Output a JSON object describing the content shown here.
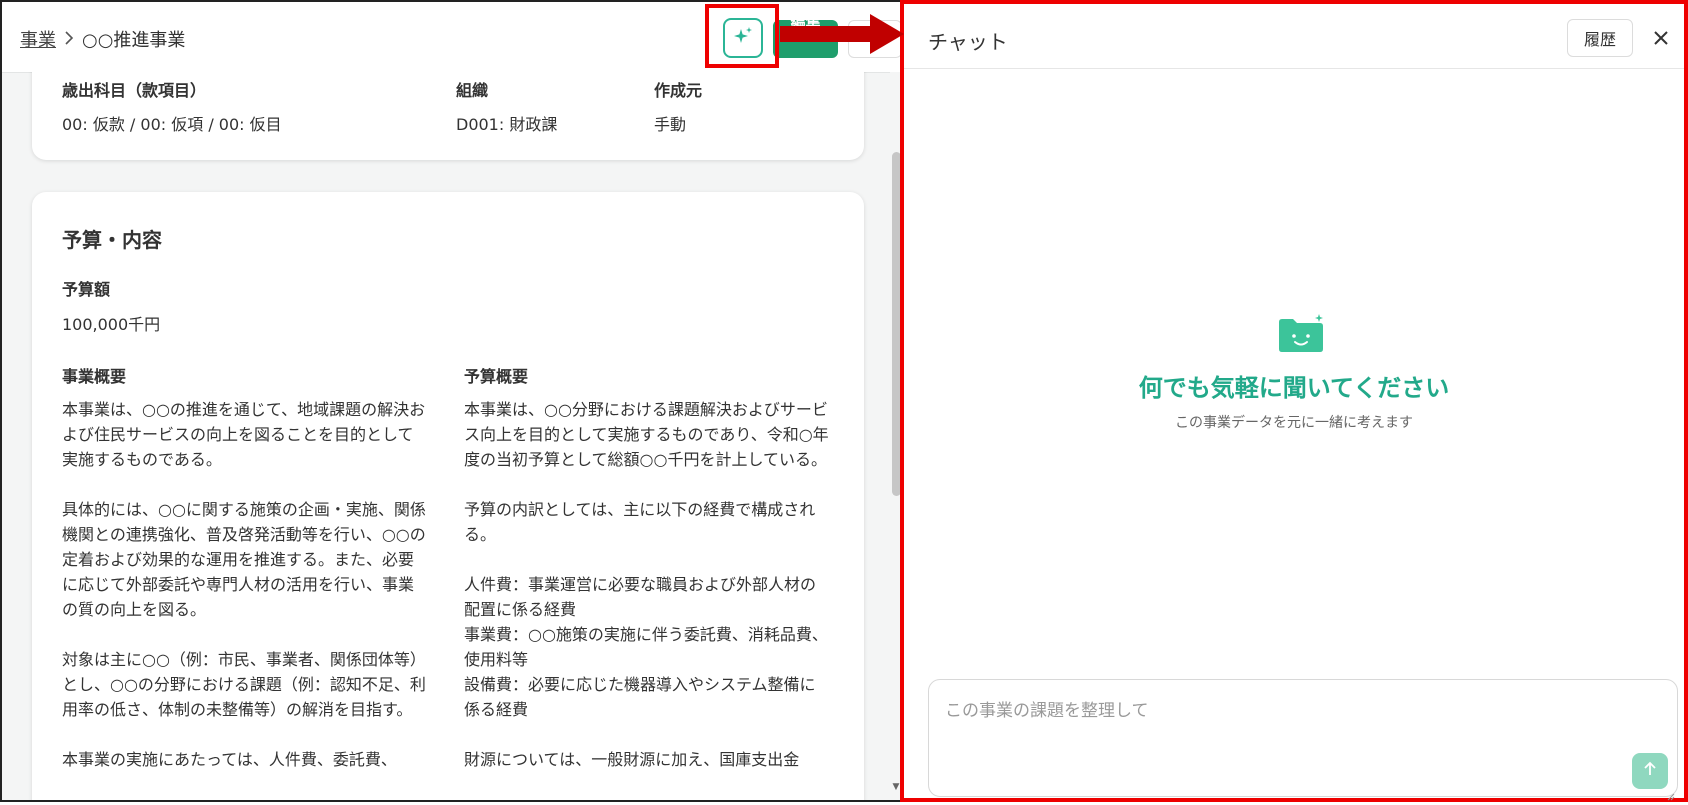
{
  "breadcrumb": {
    "root": "事業",
    "current": "○○推進事業"
  },
  "toolbar": {
    "edit_label": "編集"
  },
  "summary_card": {
    "account_label": "歳出科目（款項目）",
    "account_value": "00: 仮款 / 00: 仮項 / 00: 仮目",
    "org_label": "組織",
    "org_value": "D001: 財政課",
    "creator_label": "作成元",
    "creator_value": "手動"
  },
  "budget_card": {
    "title": "予算・内容",
    "amount_label": "予算額",
    "amount_value": "100,000千円",
    "overview_label": "事業概要",
    "overview_text": "本事業は、○○の推進を通じて、地域課題の解決および住民サービスの向上を図ることを目的として実施するものである。\n\n具体的には、○○に関する施策の企画・実施、関係機関との連携強化、普及啓発活動等を行い、○○の定着および効果的な運用を推進する。また、必要に応じて外部委託や専門人材の活用を行い、事業の質の向上を図る。\n\n対象は主に○○（例：市民、事業者、関係団体等）とし、○○の分野における課題（例：認知不足、利用率の低さ、体制の未整備等）の解消を目指す。\n\n本事業の実施にあたっては、人件費、委託費、",
    "budget_summary_label": "予算概要",
    "budget_summary_text": "本事業は、○○分野における課題解決およびサービス向上を目的として実施するものであり、令和○年度の当初予算として総額○○千円を計上している。\n\n予算の内訳としては、主に以下の経費で構成される。\n\n人件費：事業運営に必要な職員および外部人材の配置に係る経費\n事業費：○○施策の実施に伴う委託費、消耗品費、使用料等\n設備費：必要に応じた機器導入やシステム整備に係る経費\n\n財源については、一般財源に加え、国庫支出金"
  },
  "chat": {
    "title": "チャット",
    "history_label": "履歴",
    "empty_title": "何でも気軽に聞いてください",
    "empty_subtitle": "この事業データを元に一緒に考えます",
    "input_placeholder": "この事業の課題を整理して"
  },
  "colors": {
    "accent": "#22a98a",
    "primary_button": "#1f9e6c",
    "highlight": "#e00000"
  },
  "icons": [
    "sparkle-icon",
    "chevron-right-icon",
    "close-icon",
    "folder-smile-icon",
    "arrow-up-icon"
  ]
}
